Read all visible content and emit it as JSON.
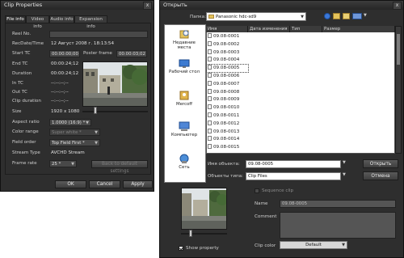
{
  "clip": {
    "title": "Clip Properties",
    "close": "x",
    "tabs": [
      "File info",
      "Video info",
      "Audio info",
      "Expansion info"
    ],
    "fields": {
      "reel_no_label": "Reel No.",
      "reel_no_value": "",
      "recdate_label": "RecDate/Time",
      "recdate_value": "12 Август 2008 г.  18:13:54",
      "start_tc_label": "Start TC",
      "start_tc_value": "00:00:00;00",
      "poster_label": "Poster frame",
      "poster_value": "00:00:03;02",
      "end_tc_label": "End TC",
      "end_tc_value": "00:00:24;12",
      "duration_label": "Duration",
      "duration_value": "00:00:24;12",
      "in_tc_label": "In TC",
      "in_tc_value": "--:--:--;--",
      "out_tc_label": "Out TC",
      "out_tc_value": "--:--:--;--",
      "clip_duration_label": "Clip duration",
      "clip_duration_value": "--:--:--;--",
      "size_label": "Size",
      "size_value": "1920 x 1080",
      "aspect_label": "Aspect ratio",
      "aspect_value": "1.0000 (16:9) *",
      "color_label": "Color range",
      "color_value": "Super white *",
      "field_label": "Field order",
      "field_value": "Top Field First *",
      "stream_label": "Stream Type",
      "stream_value": "AVCHD Stream",
      "frame_label": "Frame rate",
      "frame_value": "25 *",
      "back_default": "Back to default settings"
    },
    "ok": "OK",
    "cancel": "Cancel",
    "apply": "Apply"
  },
  "open": {
    "title": "Открыть",
    "folder_label": "Папка:",
    "folder_value": "Panasonic hdc-sd9",
    "side": [
      "Недавние места",
      "Рабочий стол",
      "Mercoff",
      "Компьютер",
      "Сеть"
    ],
    "columns": [
      "Имя",
      "Дата изменения",
      "Тип",
      "Размер"
    ],
    "files": [
      "09.08-0001",
      "09.08-0002",
      "09.08-0003",
      "09.08-0004",
      "09.08-0005",
      "09.08-0006",
      "09.08-0007",
      "09.08-0008",
      "09.08-0009",
      "09.08-0010",
      "09.08-0011",
      "09.08-0012",
      "09.08-0013",
      "09.08-0014",
      "09.08-0015"
    ],
    "selected_index": 4,
    "filename_label": "Имя объекта:",
    "filename_value": "09.08-0005",
    "filetype_label": "Объекты типа:",
    "filetype_value": "Clip Files",
    "open_btn": "Открыть",
    "cancel_btn": "Отмена",
    "sequence_clip": "Sequence clip",
    "name_label": "Name",
    "name_value": "09.08-0005",
    "comment_label": "Comment",
    "clip_color_label": "Clip color",
    "clip_color_value": "Default",
    "show_property": "Show property",
    "show_property_checked": true
  }
}
